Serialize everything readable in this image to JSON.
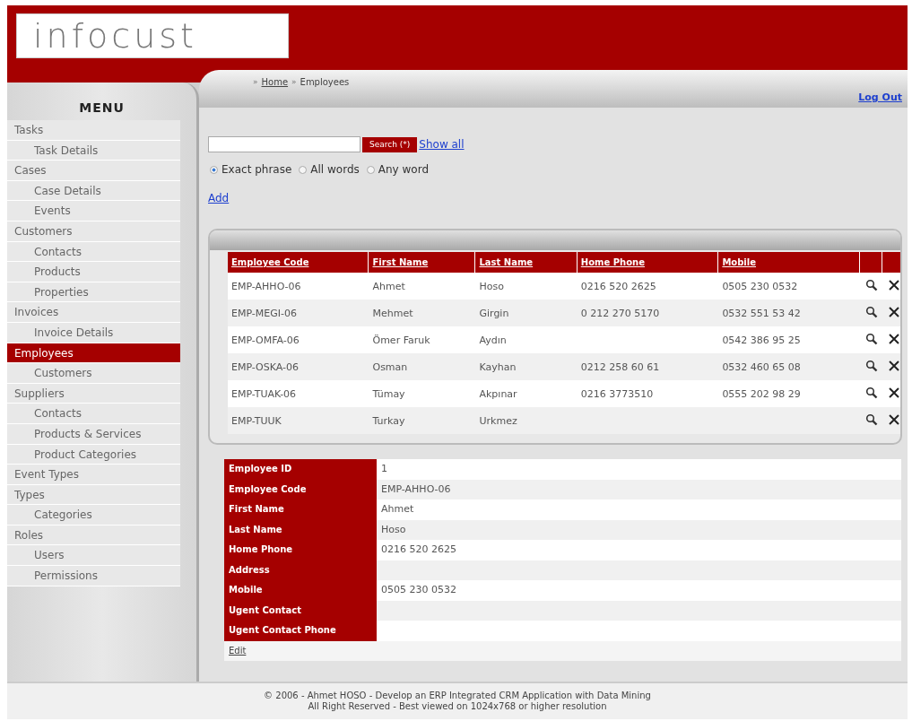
{
  "logo": {
    "text": "infocust"
  },
  "breadcrumb": {
    "separator": "»",
    "items": [
      {
        "text": "Home",
        "kind": "link"
      },
      {
        "text": "Employees",
        "kind": "current"
      }
    ]
  },
  "logout": "Log Out",
  "menu": {
    "title": "MENU",
    "items": [
      {
        "label": "Tasks",
        "selected": false,
        "children": [
          {
            "label": "Task Details",
            "selected": false
          }
        ]
      },
      {
        "label": "Cases",
        "selected": false,
        "children": [
          {
            "label": "Case Details",
            "selected": false
          },
          {
            "label": "Events",
            "selected": false
          }
        ]
      },
      {
        "label": "Customers",
        "selected": false,
        "children": [
          {
            "label": "Contacts",
            "selected": false
          },
          {
            "label": "Products",
            "selected": false
          },
          {
            "label": "Properties",
            "selected": false
          }
        ]
      },
      {
        "label": "Invoices",
        "selected": false,
        "children": [
          {
            "label": "Invoice Details",
            "selected": false
          }
        ]
      },
      {
        "label": "Employees",
        "selected": true,
        "children": [
          {
            "label": "Customers",
            "selected": false
          }
        ]
      },
      {
        "label": "Suppliers",
        "selected": false,
        "children": [
          {
            "label": "Contacts",
            "selected": false
          },
          {
            "label": "Products & Services",
            "selected": false
          },
          {
            "label": "Product Categories",
            "selected": false
          }
        ]
      },
      {
        "label": "Event Types",
        "selected": false
      },
      {
        "label": "Types",
        "selected": false,
        "children": [
          {
            "label": "Categories",
            "selected": false
          }
        ]
      },
      {
        "label": "Roles",
        "selected": false,
        "children": [
          {
            "label": "Users",
            "selected": false
          },
          {
            "label": "Permissions",
            "selected": false
          }
        ]
      }
    ]
  },
  "search": {
    "button": "Search (*)",
    "show_all": "Show all",
    "options": [
      {
        "label": "Exact phrase",
        "selected": true
      },
      {
        "label": "All words",
        "selected": false
      },
      {
        "label": "Any word",
        "selected": false
      }
    ],
    "add": "Add"
  },
  "table": {
    "columns": [
      "Employee Code",
      "First Name",
      "Last Name",
      "Home Phone",
      "Mobile"
    ],
    "rows": [
      [
        "EMP-AHHO-06",
        "Ahmet",
        "Hoso",
        "0216 520 2625",
        "0505 230 0532"
      ],
      [
        "EMP-MEGI-06",
        "Mehmet",
        "Girgin",
        "0 212 270 5170",
        "0532 551 53 42"
      ],
      [
        "EMP-OMFA-06",
        "Ömer Faruk",
        "Aydın",
        "",
        "0542 386 95 25"
      ],
      [
        "EMP-OSKA-06",
        "Osman",
        "Kayhan",
        "0212 258 60 61",
        "0532 460 65 08"
      ],
      [
        "EMP-TUAK-06",
        "Tümay",
        "Akpınar",
        "0216 3773510",
        "0555 202 98 29"
      ],
      [
        "EMP-TUUK",
        "Turkay",
        "Urkmez",
        "",
        ""
      ]
    ]
  },
  "details": {
    "fields": [
      {
        "label": "Employee ID",
        "value": "1"
      },
      {
        "label": "Employee Code",
        "value": "EMP-AHHO-06"
      },
      {
        "label": "First Name",
        "value": "Ahmet"
      },
      {
        "label": "Last Name",
        "value": "Hoso"
      },
      {
        "label": "Home Phone",
        "value": "0216 520 2625"
      },
      {
        "label": "Address"
      },
      {
        "label": "Mobile",
        "value": "0505 230 0532"
      },
      {
        "label": "Ugent Contact"
      },
      {
        "label": "Ugent Contact Phone"
      }
    ],
    "edit": "Edit"
  },
  "footer": [
    "© 2006 - Ahmet HOSO - Develop an ERP Integrated CRM Application with Data Mining",
    "All Right Reserved - Best viewed on 1024x768 or higher resolution"
  ]
}
